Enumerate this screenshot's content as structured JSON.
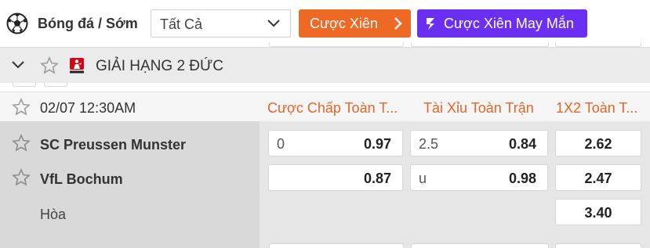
{
  "header": {
    "sport_title": "Bóng đá / Sớm",
    "filter_value": "Tất Cả",
    "parlay_label": "Cược Xiên",
    "lucky_parlay_label": "Cược Xiên May Mắn"
  },
  "league": {
    "name": "GIẢI HẠNG 2 ĐỨC"
  },
  "match": {
    "datetime": "02/07 12:30AM",
    "columns": [
      "Cược Chấp Toàn T...",
      "Tài Xỉu Toàn Trận",
      "1X2 Toàn T..."
    ],
    "home": {
      "name": "SC Preussen Munster",
      "handicap_line": "0",
      "handicap_price": "0.97",
      "ou_line": "2.5",
      "ou_price": "0.84",
      "x12": "2.62"
    },
    "away": {
      "name": "VfL Bochum",
      "handicap_line": "",
      "handicap_price": "0.87",
      "ou_line": "u",
      "ou_price": "0.98",
      "x12": "2.47"
    },
    "draw": {
      "name": "Hòa",
      "x12": "3.40"
    }
  },
  "colors": {
    "accent_orange": "#ee6a24",
    "accent_purple": "#6a2ff0",
    "column_header": "#e2652a"
  }
}
